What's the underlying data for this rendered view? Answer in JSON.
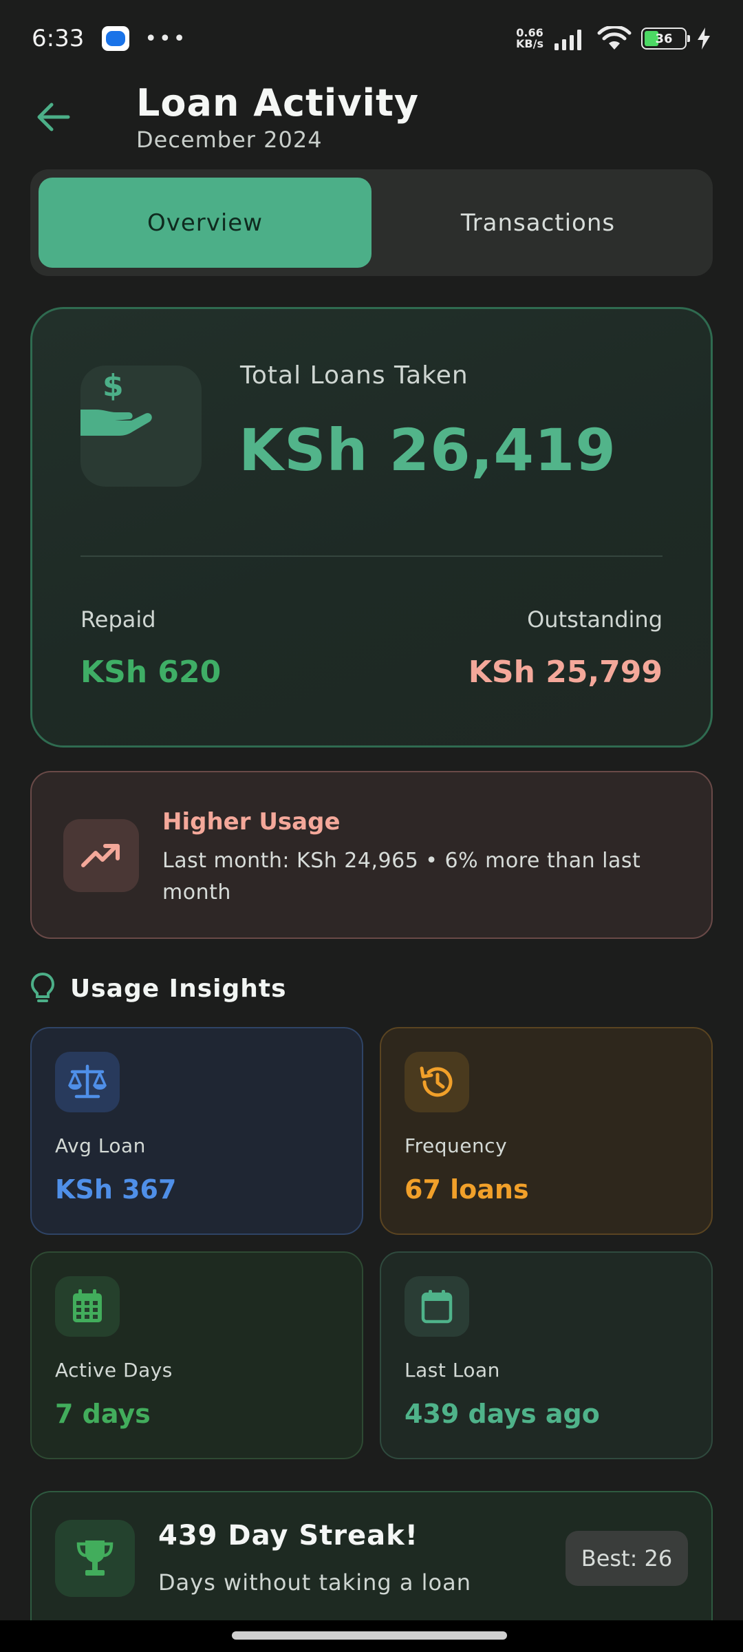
{
  "status_bar": {
    "time": "6:33",
    "dots": "•••",
    "net_speed_value": "0.66",
    "net_speed_unit": "KB/s",
    "battery_level": "36"
  },
  "header": {
    "title": "Loan Activity",
    "subtitle": "December 2024"
  },
  "tabs": [
    {
      "label": "Overview",
      "active": true
    },
    {
      "label": "Transactions",
      "active": false
    }
  ],
  "summary": {
    "total_label": "Total Loans Taken",
    "total_value": "KSh 26,419",
    "repaid_label": "Repaid",
    "repaid_value": "KSh 620",
    "outstanding_label": "Outstanding",
    "outstanding_value": "KSh 25,799"
  },
  "usage_alert": {
    "title": "Higher Usage",
    "description": "Last month: KSh 24,965 • 6% more than last month"
  },
  "insights": {
    "title": "Usage Insights",
    "cards": [
      {
        "label": "Avg Loan",
        "value": "KSh 367",
        "icon": "balance-scale-icon"
      },
      {
        "label": "Frequency",
        "value": "67 loans",
        "icon": "history-icon"
      },
      {
        "label": "Active Days",
        "value": "7 days",
        "icon": "calendar-grid-icon"
      },
      {
        "label": "Last Loan",
        "value": "439 days ago",
        "icon": "calendar-icon"
      }
    ]
  },
  "streak": {
    "title": "439 Day Streak!",
    "subtitle": "Days without taking a loan",
    "best": "Best: 26"
  },
  "colors": {
    "accent": "#4caf88",
    "repaid": "#3fae66",
    "outstanding": "#f4a89a",
    "avg": "#4f8fe8",
    "frequency": "#f1a02a"
  }
}
